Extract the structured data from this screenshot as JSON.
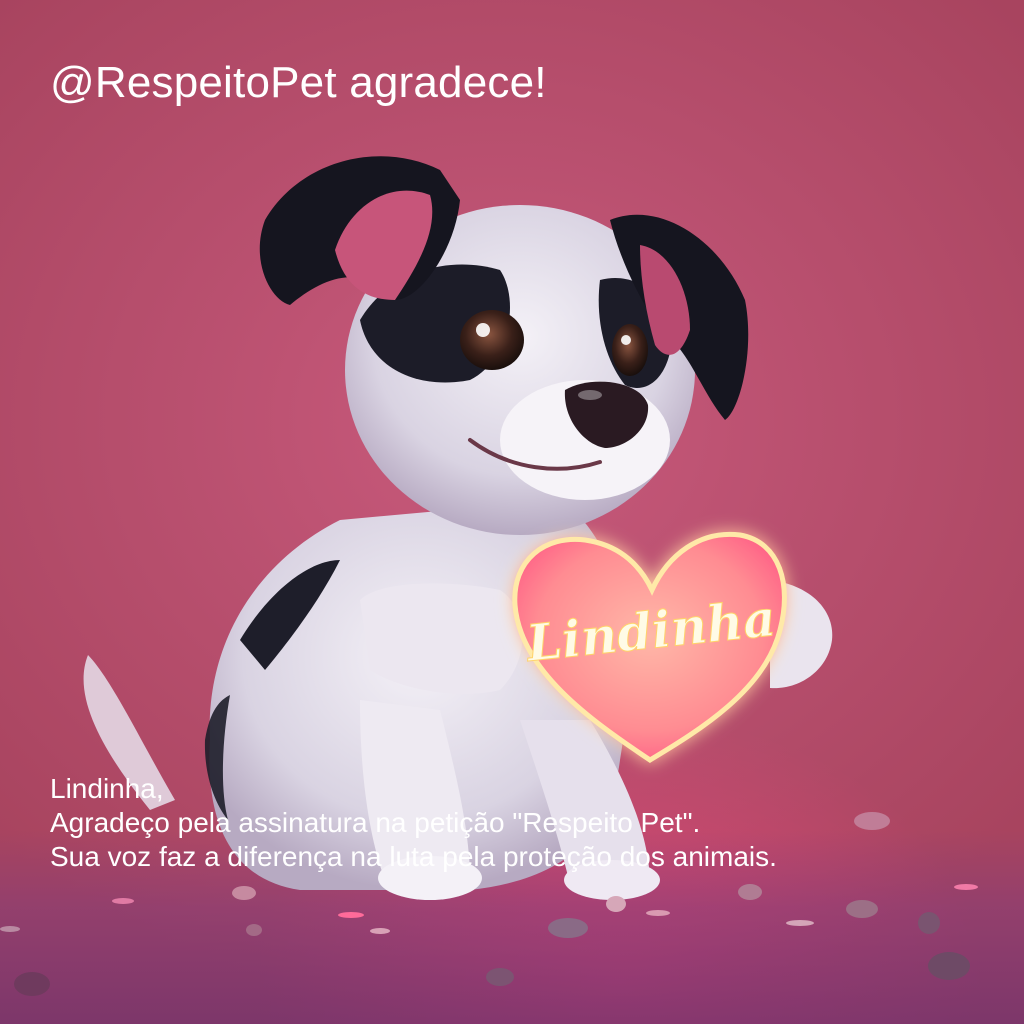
{
  "header": {
    "title": "@RespeitoPet agradece!"
  },
  "illustration": {
    "heart_text": "Lindinha"
  },
  "message": {
    "greeting": "Lindinha,",
    "line1": "Agradeço pela assinatura na petição \"Respeito Pet\".",
    "line2": "Sua voz faz a diferença na luta pela proteção dos animais."
  },
  "colors": {
    "background": "#b9506f",
    "text": "#ffffff",
    "heart_glow": "#ffe9a8"
  }
}
